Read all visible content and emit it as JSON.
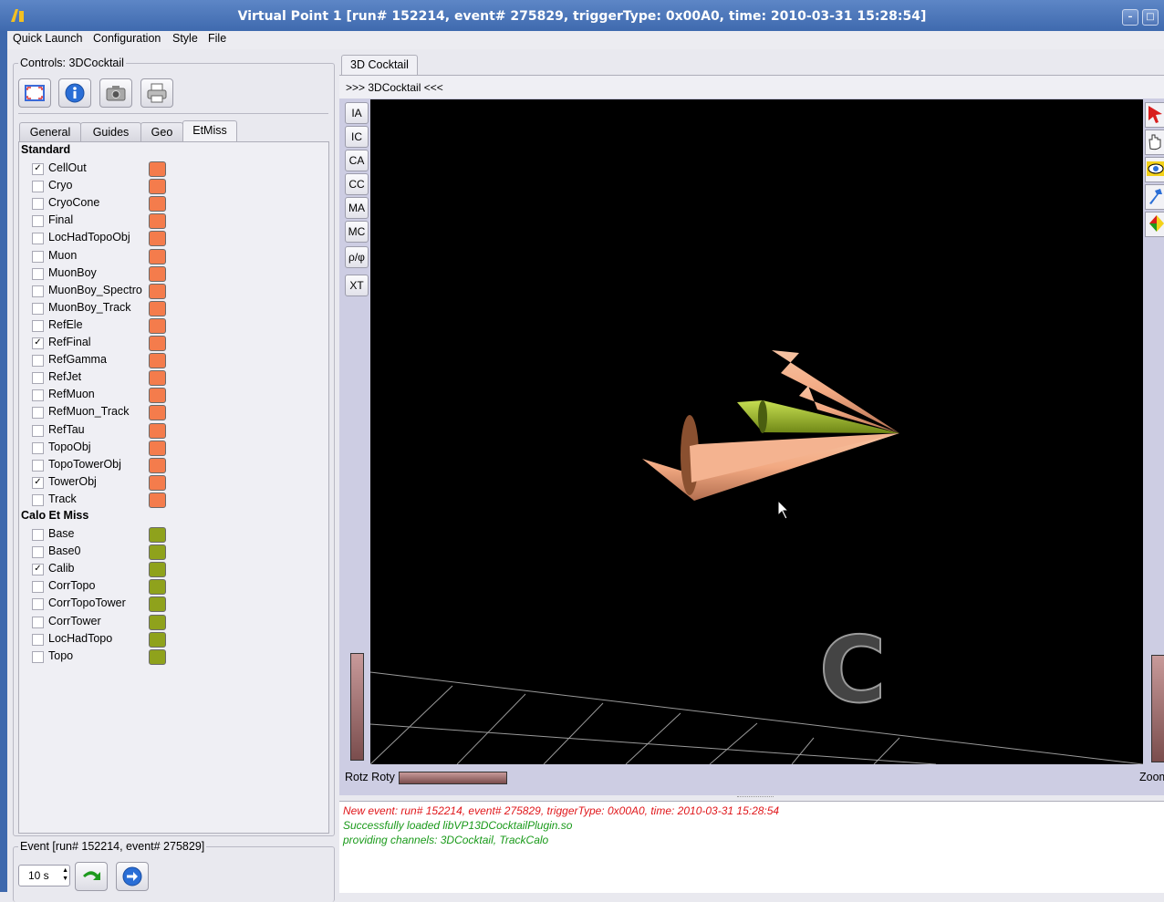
{
  "window": {
    "title": "Virtual Point 1 [run# 152214, event# 275829, triggerType: 0x00A0, time: 2010-03-31 15:28:54]",
    "minimize_glyph": "–",
    "maximize_glyph": "□"
  },
  "menu": [
    {
      "label": "Quick Launch"
    },
    {
      "label": "Configuration"
    },
    {
      "label": "Style"
    },
    {
      "label": "File"
    }
  ],
  "controls": {
    "title": "Controls: 3DCocktail",
    "toolbar_icons": [
      "fullscreen-icon",
      "info-icon",
      "camera-icon",
      "printer-icon"
    ],
    "tabs": [
      {
        "label": "General"
      },
      {
        "label": "Guides"
      },
      {
        "label": "Geo"
      },
      {
        "label": "EtMiss",
        "active": true
      }
    ],
    "sections": [
      {
        "heading": "Standard",
        "color": "#f47c4c",
        "items": [
          {
            "label": "CellOut",
            "checked": true
          },
          {
            "label": "Cryo",
            "checked": false
          },
          {
            "label": "CryoCone",
            "checked": false
          },
          {
            "label": "Final",
            "checked": false
          },
          {
            "label": "LocHadTopoObj",
            "checked": false
          },
          {
            "label": "Muon",
            "checked": false
          },
          {
            "label": "MuonBoy",
            "checked": false
          },
          {
            "label": "MuonBoy_Spectro",
            "checked": false
          },
          {
            "label": "MuonBoy_Track",
            "checked": false
          },
          {
            "label": "RefEle",
            "checked": false
          },
          {
            "label": "RefFinal",
            "checked": true
          },
          {
            "label": "RefGamma",
            "checked": false
          },
          {
            "label": "RefJet",
            "checked": false
          },
          {
            "label": "RefMuon",
            "checked": false
          },
          {
            "label": "RefMuon_Track",
            "checked": false
          },
          {
            "label": "RefTau",
            "checked": false
          },
          {
            "label": "TopoObj",
            "checked": false
          },
          {
            "label": "TopoTowerObj",
            "checked": false
          },
          {
            "label": "TowerObj",
            "checked": true
          },
          {
            "label": "Track",
            "checked": false
          }
        ]
      },
      {
        "heading": "Calo Et Miss",
        "color": "#8fa21c",
        "items": [
          {
            "label": "Base",
            "checked": false
          },
          {
            "label": "Base0",
            "checked": false
          },
          {
            "label": "Calib",
            "checked": true
          },
          {
            "label": "CorrTopo",
            "checked": false
          },
          {
            "label": "CorrTopoTower",
            "checked": false
          },
          {
            "label": "CorrTower",
            "checked": false
          },
          {
            "label": "LocHadTopo",
            "checked": false
          },
          {
            "label": "Topo",
            "checked": false
          }
        ]
      }
    ]
  },
  "event": {
    "title": "Event [run# 152214, event# 275829]",
    "interval_value": "10 s"
  },
  "view": {
    "tab_label": "3D Cocktail",
    "header": ">>> 3DCocktail <<<",
    "side_buttons": [
      "IA",
      "IC",
      "CA",
      "CC",
      "MA",
      "MC",
      "ρ/φ",
      "XT"
    ],
    "rot_label": "Rotz Roty",
    "zoom_label": "Zoom",
    "overlay_letter": "C"
  },
  "log": [
    {
      "text": "New event: run# 152214, event# 275829, triggerType: 0x00A0, time: 2010-03-31 15:28:54",
      "color": "#e0171b"
    },
    {
      "text": "Successfully loaded libVP13DCocktailPlugin.so",
      "color": "#1a9a1a"
    },
    {
      "text": "providing channels: 3DCocktail, TrackCalo",
      "color": "#1a9a1a"
    }
  ]
}
